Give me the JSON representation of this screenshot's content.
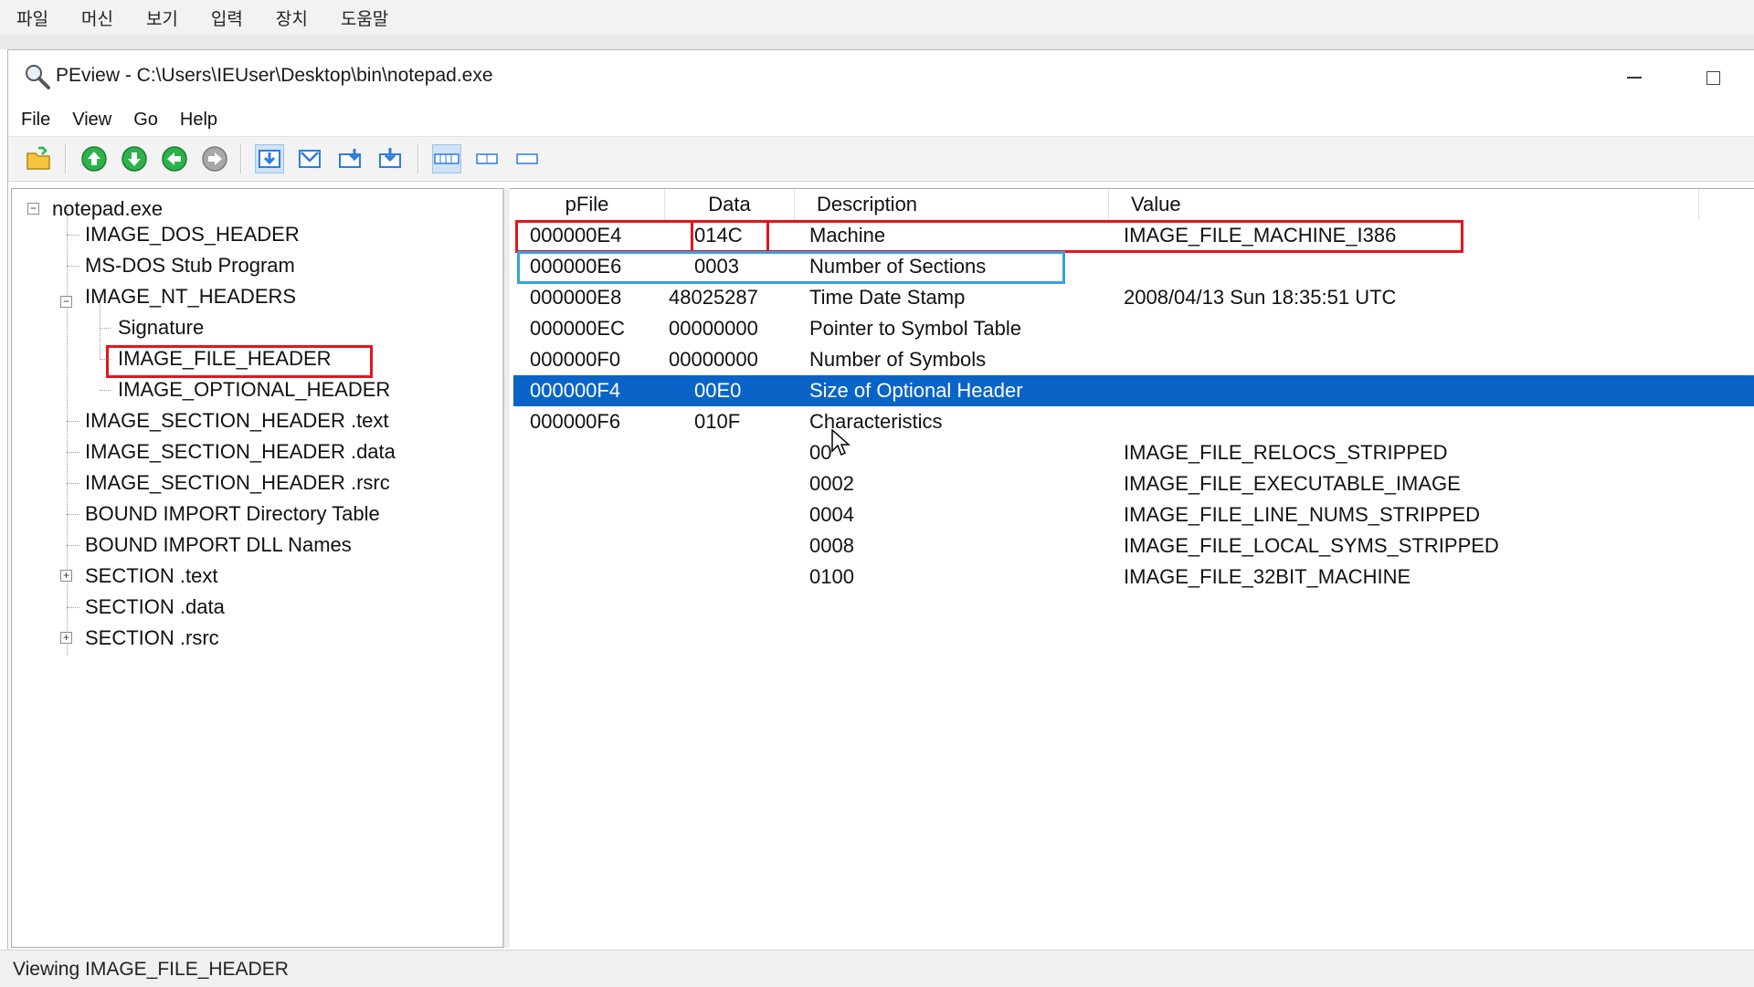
{
  "vm_menu": [
    "파일",
    "머신",
    "보기",
    "입력",
    "장치",
    "도움말"
  ],
  "window": {
    "title": "PEview - C:\\Users\\IEUser\\Desktop\\bin\\notepad.exe",
    "icon": "magnifier-icon"
  },
  "menu": [
    "File",
    "View",
    "Go",
    "Help"
  ],
  "toolbar": {
    "buttons": [
      "open-folder-icon",
      "arrow-up-icon",
      "arrow-down-icon",
      "arrow-back-icon",
      "arrow-forward-icon",
      "view-byte-icon",
      "view-word-icon",
      "view-dword-icon",
      "view-qword-icon",
      "view-wide-icon",
      "view-medium-icon",
      "view-narrow-icon"
    ],
    "accent_color": "#2f7be0",
    "nav_green": "#2bb34a"
  },
  "tree": {
    "root": "notepad.exe",
    "items": [
      "IMAGE_DOS_HEADER",
      "MS-DOS Stub Program",
      "IMAGE_NT_HEADERS",
      "Signature",
      "IMAGE_FILE_HEADER",
      "IMAGE_OPTIONAL_HEADER",
      "IMAGE_SECTION_HEADER .text",
      "IMAGE_SECTION_HEADER .data",
      "IMAGE_SECTION_HEADER .rsrc",
      "BOUND IMPORT Directory Table",
      "BOUND IMPORT DLL Names",
      "SECTION .text",
      "SECTION .data",
      "SECTION .rsrc"
    ],
    "selected": "IMAGE_FILE_HEADER"
  },
  "list": {
    "columns": [
      "pFile",
      "Data",
      "Description",
      "Value"
    ],
    "rows": [
      {
        "pfile": "000000E4",
        "data": "014C",
        "description": "Machine",
        "value": "IMAGE_FILE_MACHINE_I386"
      },
      {
        "pfile": "000000E6",
        "data": "0003",
        "description": "Number of Sections",
        "value": ""
      },
      {
        "pfile": "000000E8",
        "data": "48025287",
        "description": "Time Date Stamp",
        "value": "2008/04/13 Sun 18:35:51 UTC"
      },
      {
        "pfile": "000000EC",
        "data": "00000000",
        "description": "Pointer to Symbol Table",
        "value": ""
      },
      {
        "pfile": "000000F0",
        "data": "00000000",
        "description": "Number of Symbols",
        "value": ""
      },
      {
        "pfile": "000000F4",
        "data": "00E0",
        "description": "Size of Optional Header",
        "value": ""
      },
      {
        "pfile": "000000F6",
        "data": "010F",
        "description": "Characteristics",
        "value": ""
      },
      {
        "pfile": "",
        "data": "",
        "description": "00",
        "value": "IMAGE_FILE_RELOCS_STRIPPED"
      },
      {
        "pfile": "",
        "data": "",
        "description": "0002",
        "value": "IMAGE_FILE_EXECUTABLE_IMAGE"
      },
      {
        "pfile": "",
        "data": "",
        "description": "0004",
        "value": "IMAGE_FILE_LINE_NUMS_STRIPPED"
      },
      {
        "pfile": "",
        "data": "",
        "description": "0008",
        "value": "IMAGE_FILE_LOCAL_SYMS_STRIPPED"
      },
      {
        "pfile": "",
        "data": "",
        "description": "0100",
        "value": "IMAGE_FILE_32BIT_MACHINE"
      }
    ],
    "selected_row": 5,
    "highlight_red": "#e4141c",
    "highlight_blue": "#33a3e4",
    "selection_color": "#0a64c8"
  },
  "status": "Viewing IMAGE_FILE_HEADER"
}
